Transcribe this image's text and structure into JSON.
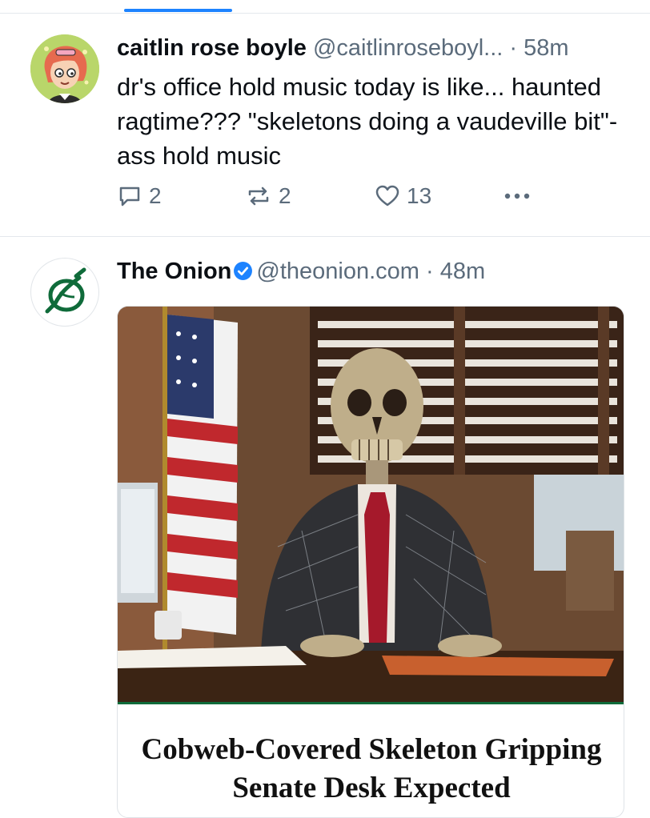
{
  "posts": [
    {
      "author": {
        "display_name": "caitlin rose boyle",
        "handle": "@caitlinroseboyl...",
        "time": "58m"
      },
      "text": "dr's office hold music today is like... haunted ragtime??? \"skeletons doing a vaudeville bit\"-ass hold music",
      "counts": {
        "replies": "2",
        "reposts": "2",
        "likes": "13"
      }
    },
    {
      "author": {
        "display_name": "The Onion",
        "handle": "@theonion.com",
        "time": "48m",
        "verified": true
      },
      "link_card": {
        "title": "Cobweb-Covered Skeleton Gripping Senate Desk Expected"
      }
    }
  ],
  "separator": "·",
  "colors": {
    "accent": "#1d83ff",
    "onion_green": "#0f6b3a",
    "muted_text": "#5b6b7b"
  },
  "icons": {
    "reply": "speech-bubble-icon",
    "repost": "repost-icon",
    "like": "heart-icon",
    "more": "ellipsis-icon",
    "verified": "verified-badge-icon"
  }
}
